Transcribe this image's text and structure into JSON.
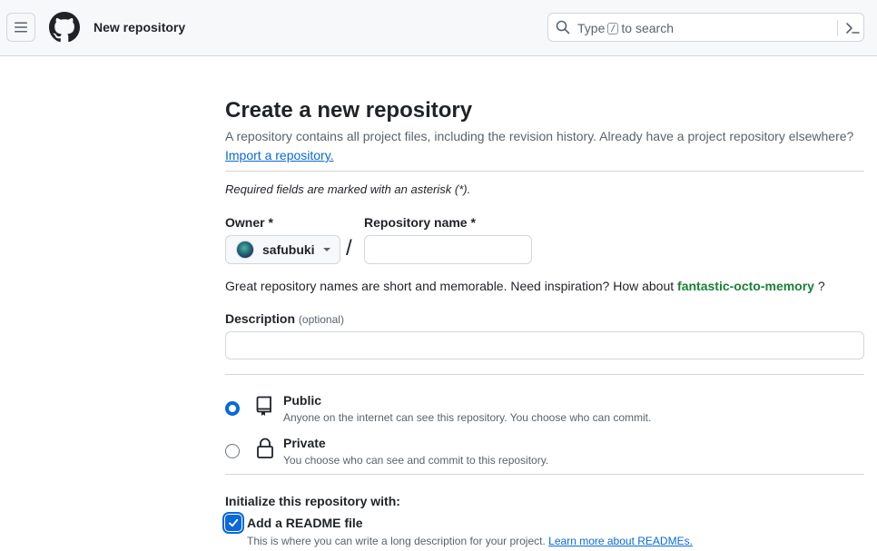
{
  "header": {
    "page_title": "New repository",
    "search": {
      "prefix": "Type",
      "key": "/",
      "suffix": "to search"
    }
  },
  "main": {
    "title": "Create a new repository",
    "subtitle": "A repository contains all project files, including the revision history. Already have a project repository elsewhere?",
    "import_link": "Import a repository.",
    "required_note": "Required fields are marked with an asterisk (*).",
    "owner_label": "Owner *",
    "owner_value": "safubuki",
    "slash": "/",
    "repo_name_label": "Repository name *",
    "repo_name_value": "",
    "inspiration_text": "Great repository names are short and memorable. Need inspiration? How about",
    "inspiration_suggestion": "fantastic-octo-memory",
    "inspiration_end": "?",
    "description_label": "Description",
    "description_optional": "(optional)",
    "description_value": "",
    "visibility": {
      "public": {
        "title": "Public",
        "desc": "Anyone on the internet can see this repository. You choose who can commit.",
        "selected": true
      },
      "private": {
        "title": "Private",
        "desc": "You choose who can see and commit to this repository.",
        "selected": false
      }
    },
    "init": {
      "label": "Initialize this repository with:",
      "readme_label": "Add a README file",
      "readme_checked": true,
      "readme_desc": "This is where you can write a long description for your project.",
      "readme_link": "Learn more about READMEs."
    }
  },
  "colors": {
    "accent": "#0969da",
    "success": "#1a7f37",
    "border": "#d0d7de",
    "muted": "#59636e"
  }
}
